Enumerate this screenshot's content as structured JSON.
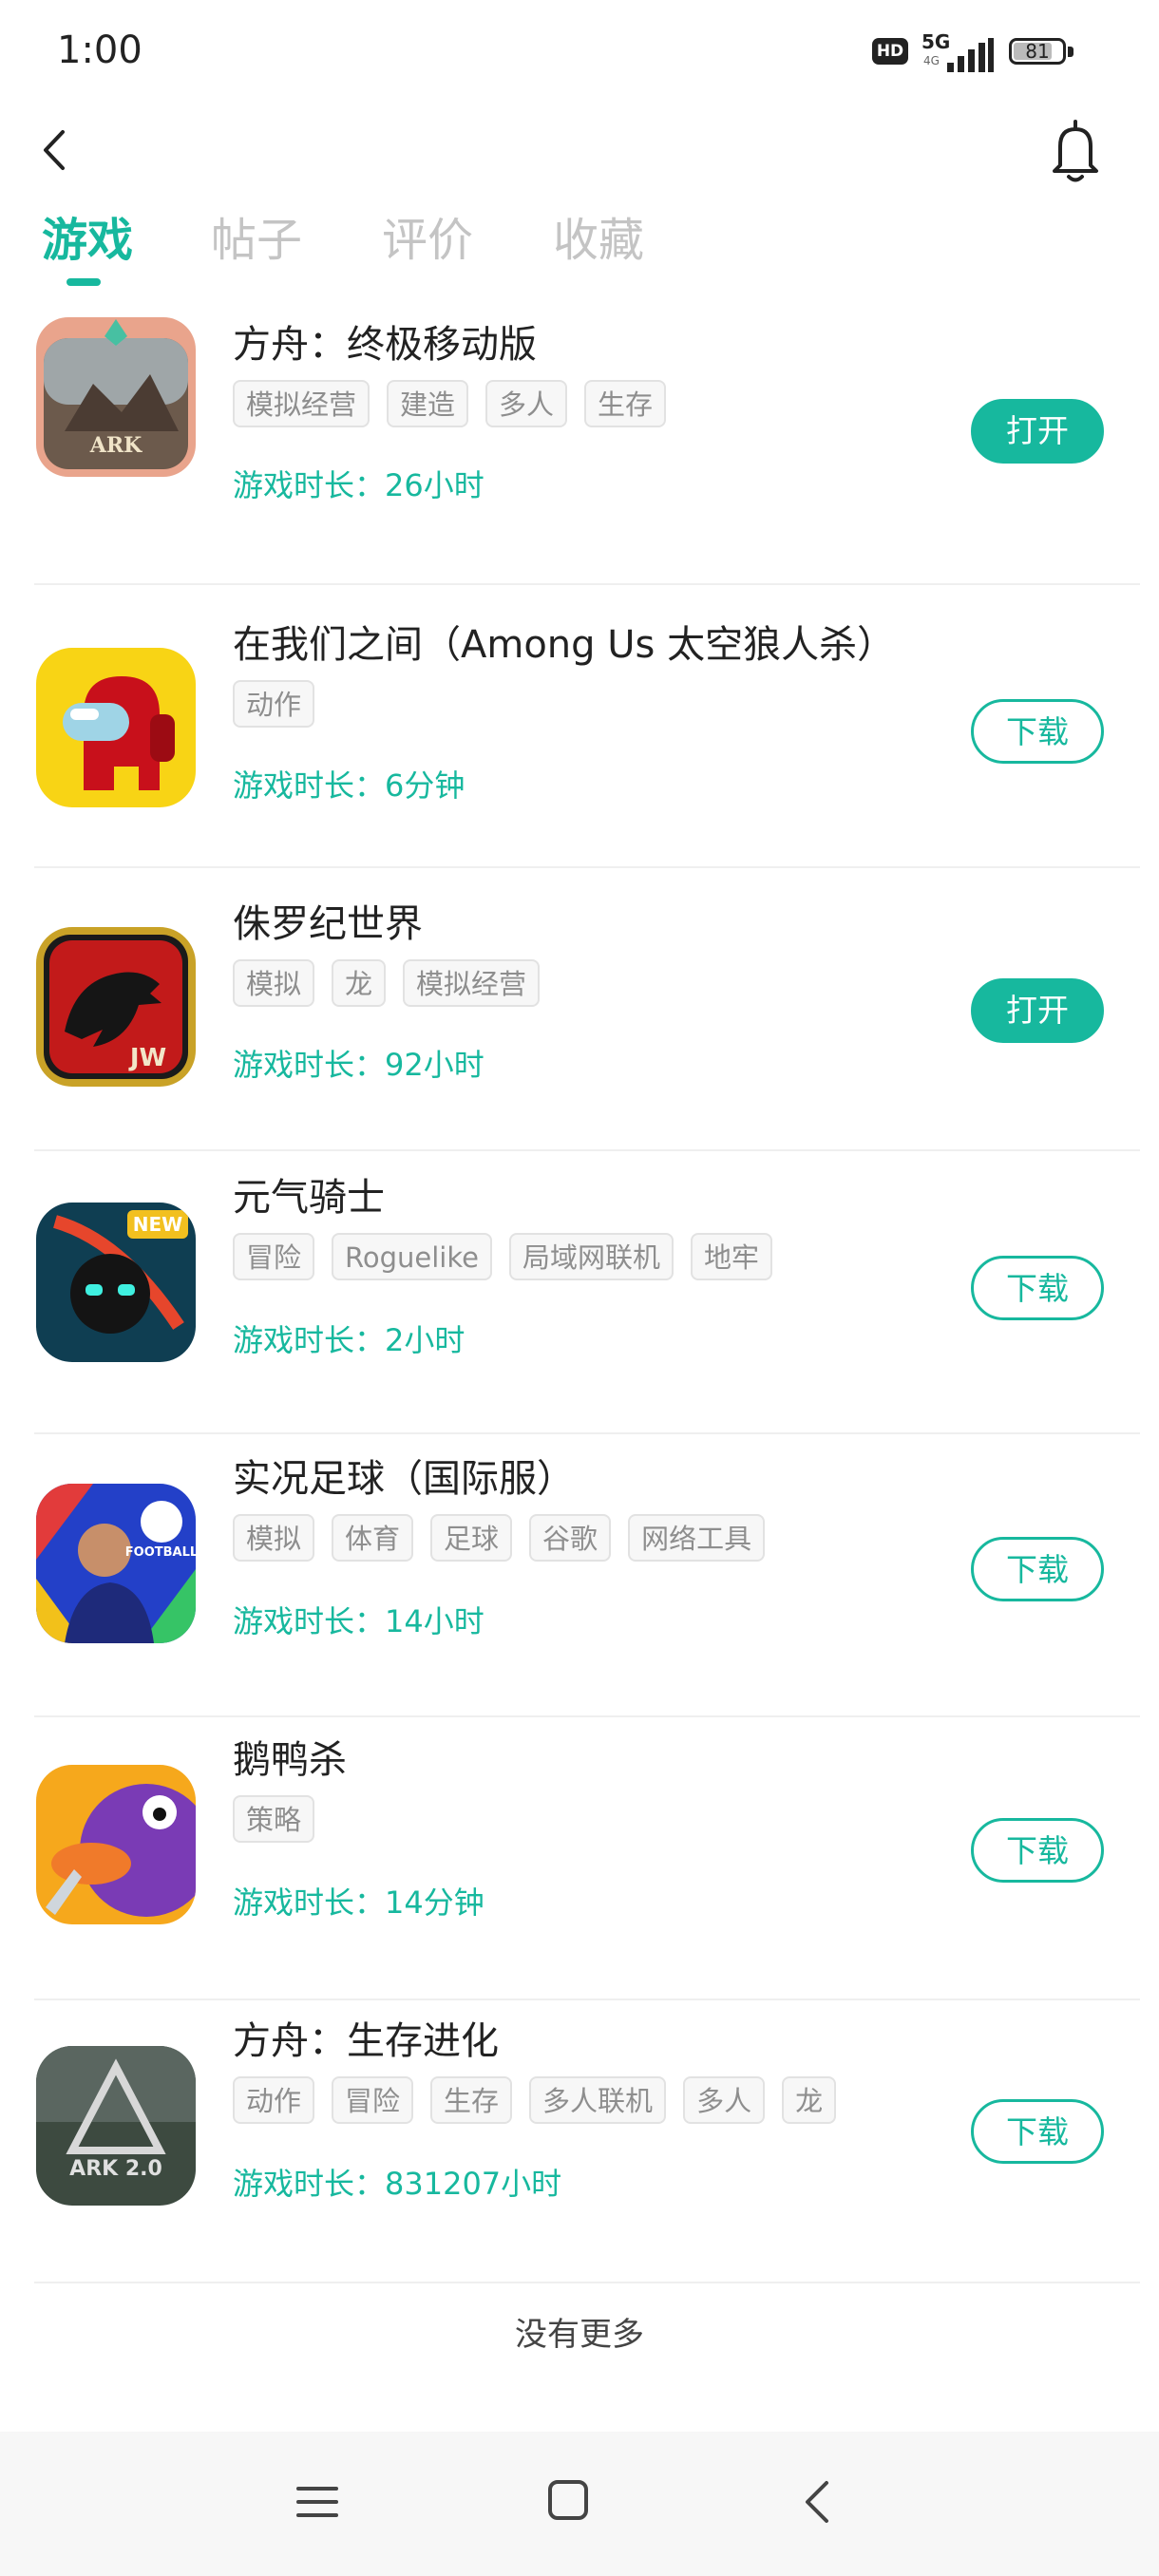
{
  "status_bar": {
    "time": "1:00",
    "hd": "HD",
    "network": "5G",
    "network_sub": "4G",
    "battery": "81"
  },
  "header": {
    "back_icon": "chevron-left-icon",
    "bell_icon": "bell-icon"
  },
  "tabs": [
    {
      "label": "游戏",
      "active": true
    },
    {
      "label": "帖子",
      "active": false
    },
    {
      "label": "评价",
      "active": false
    },
    {
      "label": "收藏",
      "active": false
    }
  ],
  "games": [
    {
      "title": "方舟：终极移动版",
      "tags": [
        "模拟经营",
        "建造",
        "多人",
        "生存"
      ],
      "playtime": "游戏时长：26小时",
      "action": "打开",
      "action_type": "open"
    },
    {
      "title": "在我们之间（Among Us 太空狼人杀）",
      "tags": [
        "动作"
      ],
      "playtime": "游戏时长：6分钟",
      "action": "下载",
      "action_type": "download"
    },
    {
      "title": "侏罗纪世界",
      "tags": [
        "模拟",
        "龙",
        "模拟经营"
      ],
      "playtime": "游戏时长：92小时",
      "action": "打开",
      "action_type": "open"
    },
    {
      "title": "元气骑士",
      "tags": [
        "冒险",
        "Roguelike",
        "局域网联机",
        "地牢"
      ],
      "playtime": "游戏时长：2小时",
      "action": "下载",
      "action_type": "download"
    },
    {
      "title": "实况足球（国际服）",
      "tags": [
        "模拟",
        "体育",
        "足球",
        "谷歌",
        "网络工具"
      ],
      "playtime": "游戏时长：14小时",
      "action": "下载",
      "action_type": "download"
    },
    {
      "title": "鹅鸭杀",
      "tags": [
        "策略"
      ],
      "playtime": "游戏时长：14分钟",
      "action": "下载",
      "action_type": "download"
    },
    {
      "title": "方舟：生存进化",
      "tags": [
        "动作",
        "冒险",
        "生存",
        "多人联机",
        "多人",
        "龙"
      ],
      "playtime": "游戏时长：831207小时",
      "action": "下载",
      "action_type": "download"
    }
  ],
  "footer_text": "没有更多",
  "icon_badges": {
    "ark": "ARK",
    "jw": "JW",
    "new": "NEW",
    "football": "FOOTBALL",
    "ark2": "ARK 2.0"
  },
  "colors": {
    "accent": "#17b89e",
    "tab_inactive": "#c4c4c4",
    "tag_text": "#8e8e8e"
  }
}
